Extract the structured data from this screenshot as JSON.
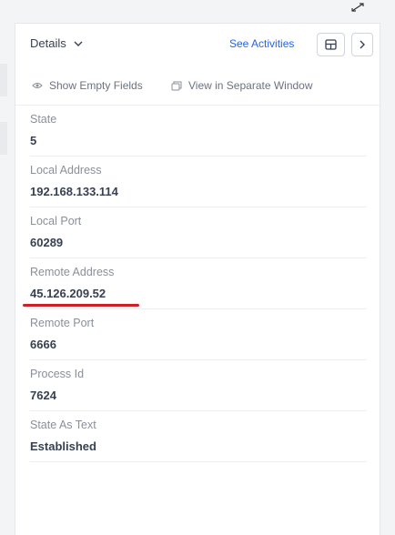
{
  "header": {
    "title": "Details",
    "see_activities": "See Activities"
  },
  "toolbar": {
    "show_empty_fields": "Show Empty Fields",
    "view_separate_window": "View in Separate Window"
  },
  "fields": [
    {
      "label": "State",
      "value": "5"
    },
    {
      "label": "Local Address",
      "value": "192.168.133.114"
    },
    {
      "label": "Local Port",
      "value": "60289"
    },
    {
      "label": "Remote Address",
      "value": "45.126.209.52"
    },
    {
      "label": "Remote Port",
      "value": "6666"
    },
    {
      "label": "Process Id",
      "value": "7624"
    },
    {
      "label": "State As Text",
      "value": "Established"
    }
  ],
  "colors": {
    "accent": "#2563eb",
    "highlight": "#d11f2a"
  },
  "icons": [
    "expand-icon",
    "chevron-down-icon",
    "layout-icon",
    "chevron-right-icon",
    "eye-icon",
    "window-icon"
  ]
}
